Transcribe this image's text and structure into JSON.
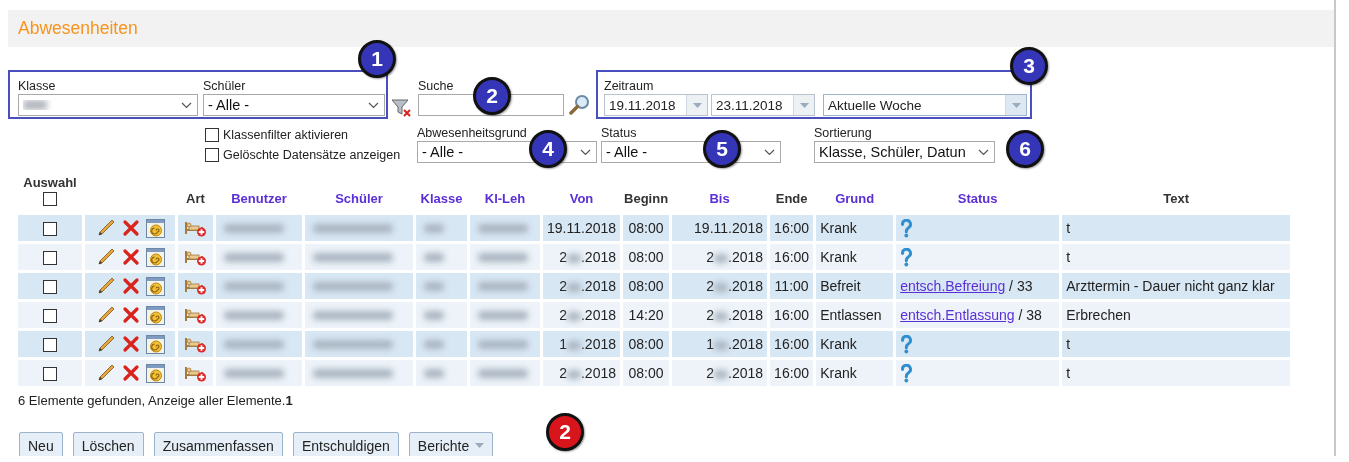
{
  "title": "Abwesenheiten",
  "filters": {
    "klasse": {
      "label": "Klasse"
    },
    "schueler": {
      "label": "Schüler",
      "value": "- Alle -"
    },
    "suche": {
      "label": "Suche"
    },
    "zeitraum": {
      "label": "Zeitraum",
      "from": "19.11.2018",
      "to": "23.11.2018",
      "preset": "Aktuelle Woche"
    },
    "checkboxes": [
      {
        "label": "Klassenfilter aktivieren",
        "checked": false
      },
      {
        "label": "Gelöschte Datensätze anzeigen",
        "checked": false
      }
    ],
    "abwesenheitsgrund": {
      "label": "Abwesenheitsgrund",
      "value": "- Alle -"
    },
    "status": {
      "label": "Status",
      "value": "- Alle -"
    },
    "sortierung": {
      "label": "Sortierung",
      "value": "Klasse, Schüler, Datun"
    }
  },
  "table": {
    "select_all": {
      "label": "Auswahl",
      "checked": false
    },
    "columns": [
      {
        "label": "Art",
        "sortable": false
      },
      {
        "label": "Benutzer",
        "sortable": true
      },
      {
        "label": "Schüler",
        "sortable": true
      },
      {
        "label": "Klasse",
        "sortable": true
      },
      {
        "label": "Kl-Leh",
        "sortable": true
      },
      {
        "label": "Von",
        "sortable": true
      },
      {
        "label": "Beginn",
        "sortable": false
      },
      {
        "label": "Bis",
        "sortable": true
      },
      {
        "label": "Ende",
        "sortable": false
      },
      {
        "label": "Grund",
        "sortable": true
      },
      {
        "label": "Status",
        "sortable": true
      },
      {
        "label": "Text",
        "sortable": false
      }
    ],
    "rows": [
      {
        "checked": false,
        "von": {
          "start": "19.11.2018"
        },
        "beginn": "08:00",
        "bis": {
          "start": "19.11.2018"
        },
        "ende": "16:00",
        "grund": "Krank",
        "status": {
          "kind": "open"
        },
        "text": "t"
      },
      {
        "checked": false,
        "von": {
          "start": "2",
          "end": ".2018"
        },
        "beginn": "08:00",
        "bis": {
          "start": "2",
          "end": ".2018"
        },
        "ende": "16:00",
        "grund": "Krank",
        "status": {
          "kind": "open"
        },
        "text": "t"
      },
      {
        "checked": false,
        "von": {
          "start": "2",
          "end": ".2018"
        },
        "beginn": "08:00",
        "bis": {
          "start": "2",
          "end": ".2018"
        },
        "ende": "11:00",
        "grund": "Befreit",
        "status": {
          "kind": "link",
          "link": "entsch.Befreiung",
          "count": "/ 33"
        },
        "text": "Arzttermin - Dauer nicht ganz klar"
      },
      {
        "checked": false,
        "von": {
          "start": "2",
          "end": ".2018"
        },
        "beginn": "14:20",
        "bis": {
          "start": "2",
          "end": ".2018"
        },
        "ende": "16:00",
        "grund": "Entlassen",
        "status": {
          "kind": "link",
          "link": "entsch.Entlassung",
          "count": "/ 38"
        },
        "text": "Erbrechen"
      },
      {
        "checked": false,
        "von": {
          "start": "1",
          "end": ".2018"
        },
        "beginn": "08:00",
        "bis": {
          "start": "1",
          "end": ".2018"
        },
        "ende": "16:00",
        "grund": "Krank",
        "status": {
          "kind": "open"
        },
        "text": "t"
      },
      {
        "checked": false,
        "von": {
          "start": "2",
          "end": ".2018"
        },
        "beginn": "08:00",
        "bis": {
          "start": "2",
          "end": ".2018"
        },
        "ende": "16:00",
        "grund": "Krank",
        "status": {
          "kind": "open"
        },
        "text": "t"
      }
    ]
  },
  "summary": "6 Elemente gefunden, Anzeige aller Elemente.**1**",
  "buttons": [
    {
      "label": "Neu",
      "kind": "plain"
    },
    {
      "label": "Löschen",
      "kind": "plain"
    },
    {
      "label": "Zusammenfassen",
      "kind": "plain"
    },
    {
      "label": "Entschuldigen",
      "kind": "plain"
    },
    {
      "label": "Berichte",
      "kind": "menu"
    }
  ],
  "callouts": [
    {
      "number": "1",
      "color": "#3535b8"
    },
    {
      "number": "2",
      "color": "#3535b8"
    },
    {
      "number": "3",
      "color": "#3535b8"
    },
    {
      "number": "4",
      "color": "#3535b8"
    },
    {
      "number": "5",
      "color": "#3535b8"
    },
    {
      "number": "6",
      "color": "#3535b8"
    },
    {
      "number": "2",
      "color": "#d8141c"
    }
  ]
}
